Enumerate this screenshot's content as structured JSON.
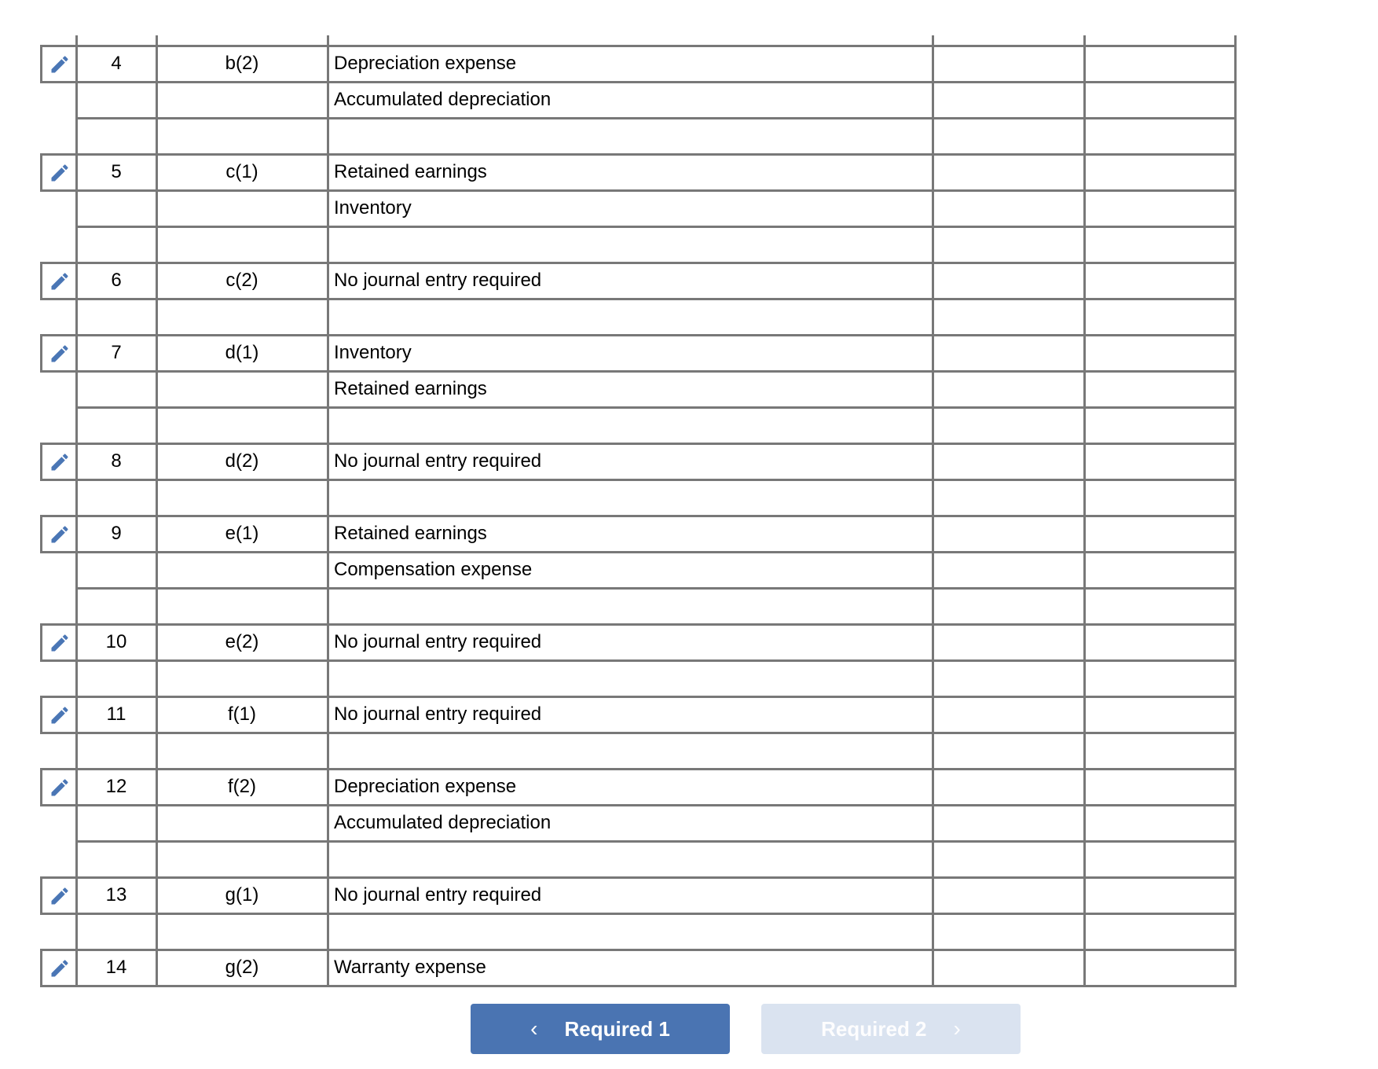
{
  "table": {
    "entries": [
      {
        "no": "4",
        "transaction": "b(2)",
        "accounts": [
          "Depreciation expense",
          "Accumulated depreciation",
          ""
        ]
      },
      {
        "no": "5",
        "transaction": "c(1)",
        "accounts": [
          "Retained earnings",
          "Inventory",
          ""
        ]
      },
      {
        "no": "6",
        "transaction": "c(2)",
        "accounts": [
          "No journal entry required",
          ""
        ]
      },
      {
        "no": "7",
        "transaction": "d(1)",
        "accounts": [
          "Inventory",
          "Retained earnings",
          ""
        ]
      },
      {
        "no": "8",
        "transaction": "d(2)",
        "accounts": [
          "No journal entry required",
          ""
        ]
      },
      {
        "no": "9",
        "transaction": "e(1)",
        "accounts": [
          "Retained earnings",
          "Compensation expense",
          ""
        ]
      },
      {
        "no": "10",
        "transaction": "e(2)",
        "accounts": [
          "No journal entry required",
          ""
        ]
      },
      {
        "no": "11",
        "transaction": "f(1)",
        "accounts": [
          "No journal entry required",
          ""
        ]
      },
      {
        "no": "12",
        "transaction": "f(2)",
        "accounts": [
          "Depreciation expense",
          "Accumulated depreciation",
          ""
        ]
      },
      {
        "no": "13",
        "transaction": "g(1)",
        "accounts": [
          "No journal entry required",
          ""
        ]
      },
      {
        "no": "14",
        "transaction": "g(2)",
        "accounts": [
          "Warranty expense"
        ]
      }
    ],
    "edit_icon": "pencil-icon"
  },
  "navigation": {
    "prev_label": "Required 1",
    "prev_icon": "‹",
    "next_label": "Required 2",
    "next_icon": "›",
    "next_disabled": true
  },
  "colors": {
    "accent": "#4a74b2",
    "disabled": "#dae3f0",
    "border": "#787878",
    "icon": "#4a76b5"
  }
}
